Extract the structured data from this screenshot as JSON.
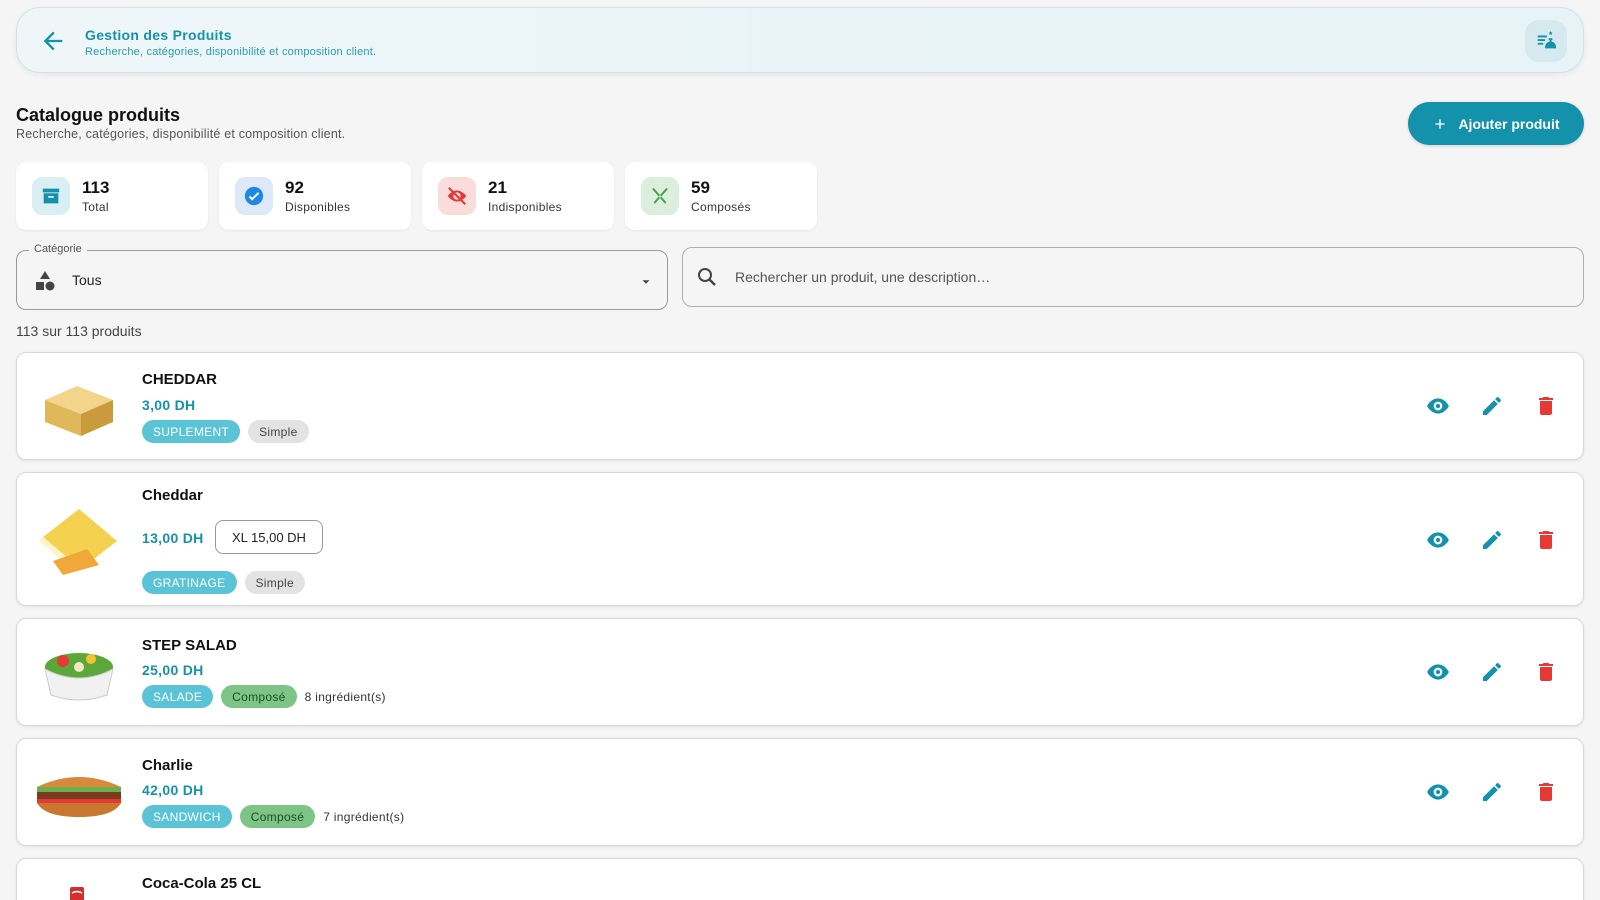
{
  "appbar": {
    "title": "Gestion des Produits",
    "subtitle": "Recherche, catégories, disponibilité et composition client."
  },
  "header": {
    "title": "Catalogue produits",
    "subtitle": "Recherche, catégories, disponibilité et composition client.",
    "add_label": "Ajouter produit"
  },
  "stats": [
    {
      "value": "113",
      "label": "Total",
      "icon": "archive-icon",
      "color": "#1592ab"
    },
    {
      "value": "92",
      "label": "Disponibles",
      "icon": "check-circle-icon",
      "color": "#1e88e5"
    },
    {
      "value": "21",
      "label": "Indisponibles",
      "icon": "eye-off-icon",
      "color": "#e53935"
    },
    {
      "value": "59",
      "label": "Composés",
      "icon": "utensils-icon",
      "color": "#43a047"
    }
  ],
  "filters": {
    "category_label": "Catégorie",
    "category_value": "Tous",
    "search_placeholder": "Rechercher un produit, une description…"
  },
  "count_text": "113 sur 113 produits",
  "products": [
    {
      "name": "CHEDDAR",
      "price": "3,00 DH",
      "category": "SUPLEMENT",
      "kind": "Simple",
      "image": "cheese-block-image"
    },
    {
      "name": "Cheddar",
      "price": "13,00 DH",
      "variant": "XL 15,00 DH",
      "category": "GRATINAGE",
      "kind": "Simple",
      "image": "cheese-slices-image"
    },
    {
      "name": "STEP SALAD",
      "price": "25,00 DH",
      "category": "SALADE",
      "kind": "Composé",
      "ingredients": "8 ingrédient(s)",
      "image": "salad-bowl-image"
    },
    {
      "name": "Charlie",
      "price": "42,00 DH",
      "category": "SANDWICH",
      "kind": "Composé",
      "ingredients": "7 ingrédient(s)",
      "image": "sandwich-image"
    },
    {
      "name": "Coca-Cola 25 CL",
      "image": "soda-can-image"
    }
  ],
  "colors": {
    "primary": "#1592ab",
    "delete": "#e53935",
    "tag_category": "#5bc3d6",
    "tag_compose": "#7dc587"
  }
}
